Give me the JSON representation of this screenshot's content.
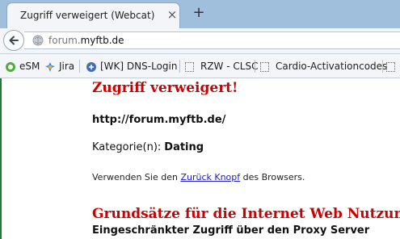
{
  "browser": {
    "tab_title": "Zugriff verweigert (Webcat)",
    "tab_close": "×",
    "new_tab": "+",
    "url_prefix": "forum.",
    "url_domain": "myftb.de",
    "bookmarks": [
      {
        "label": "eSM",
        "icon": "esm-icon"
      },
      {
        "label": "Jira",
        "icon": "jira-icon"
      },
      {
        "label": "[WK] DNS-Login",
        "icon": "dns-icon"
      },
      {
        "label": "RZW - CLSC",
        "icon": "folder-icon"
      },
      {
        "label": "Cardio-Activationcodes",
        "icon": "folder-icon"
      }
    ]
  },
  "page": {
    "heading": "Zugriff verweigert!",
    "blocked_url": "http://forum.myftb.de/",
    "category_label": "Kategorie(n):",
    "category_value": "Dating",
    "hint_before": "Verwenden Sie den ",
    "hint_link": "Zurück Knopf",
    "hint_after": " des Browsers.",
    "section_heading": "Grundsätze für die Internet Web Nutzung",
    "section_sub": "Eingeschränkter Zugriff über den Proxy Server"
  },
  "colors": {
    "tabstrip": "#9fbfdc",
    "heading_red": "#cc0000",
    "link_blue": "#1a1ad2",
    "left_rule": "#1e7b34"
  }
}
